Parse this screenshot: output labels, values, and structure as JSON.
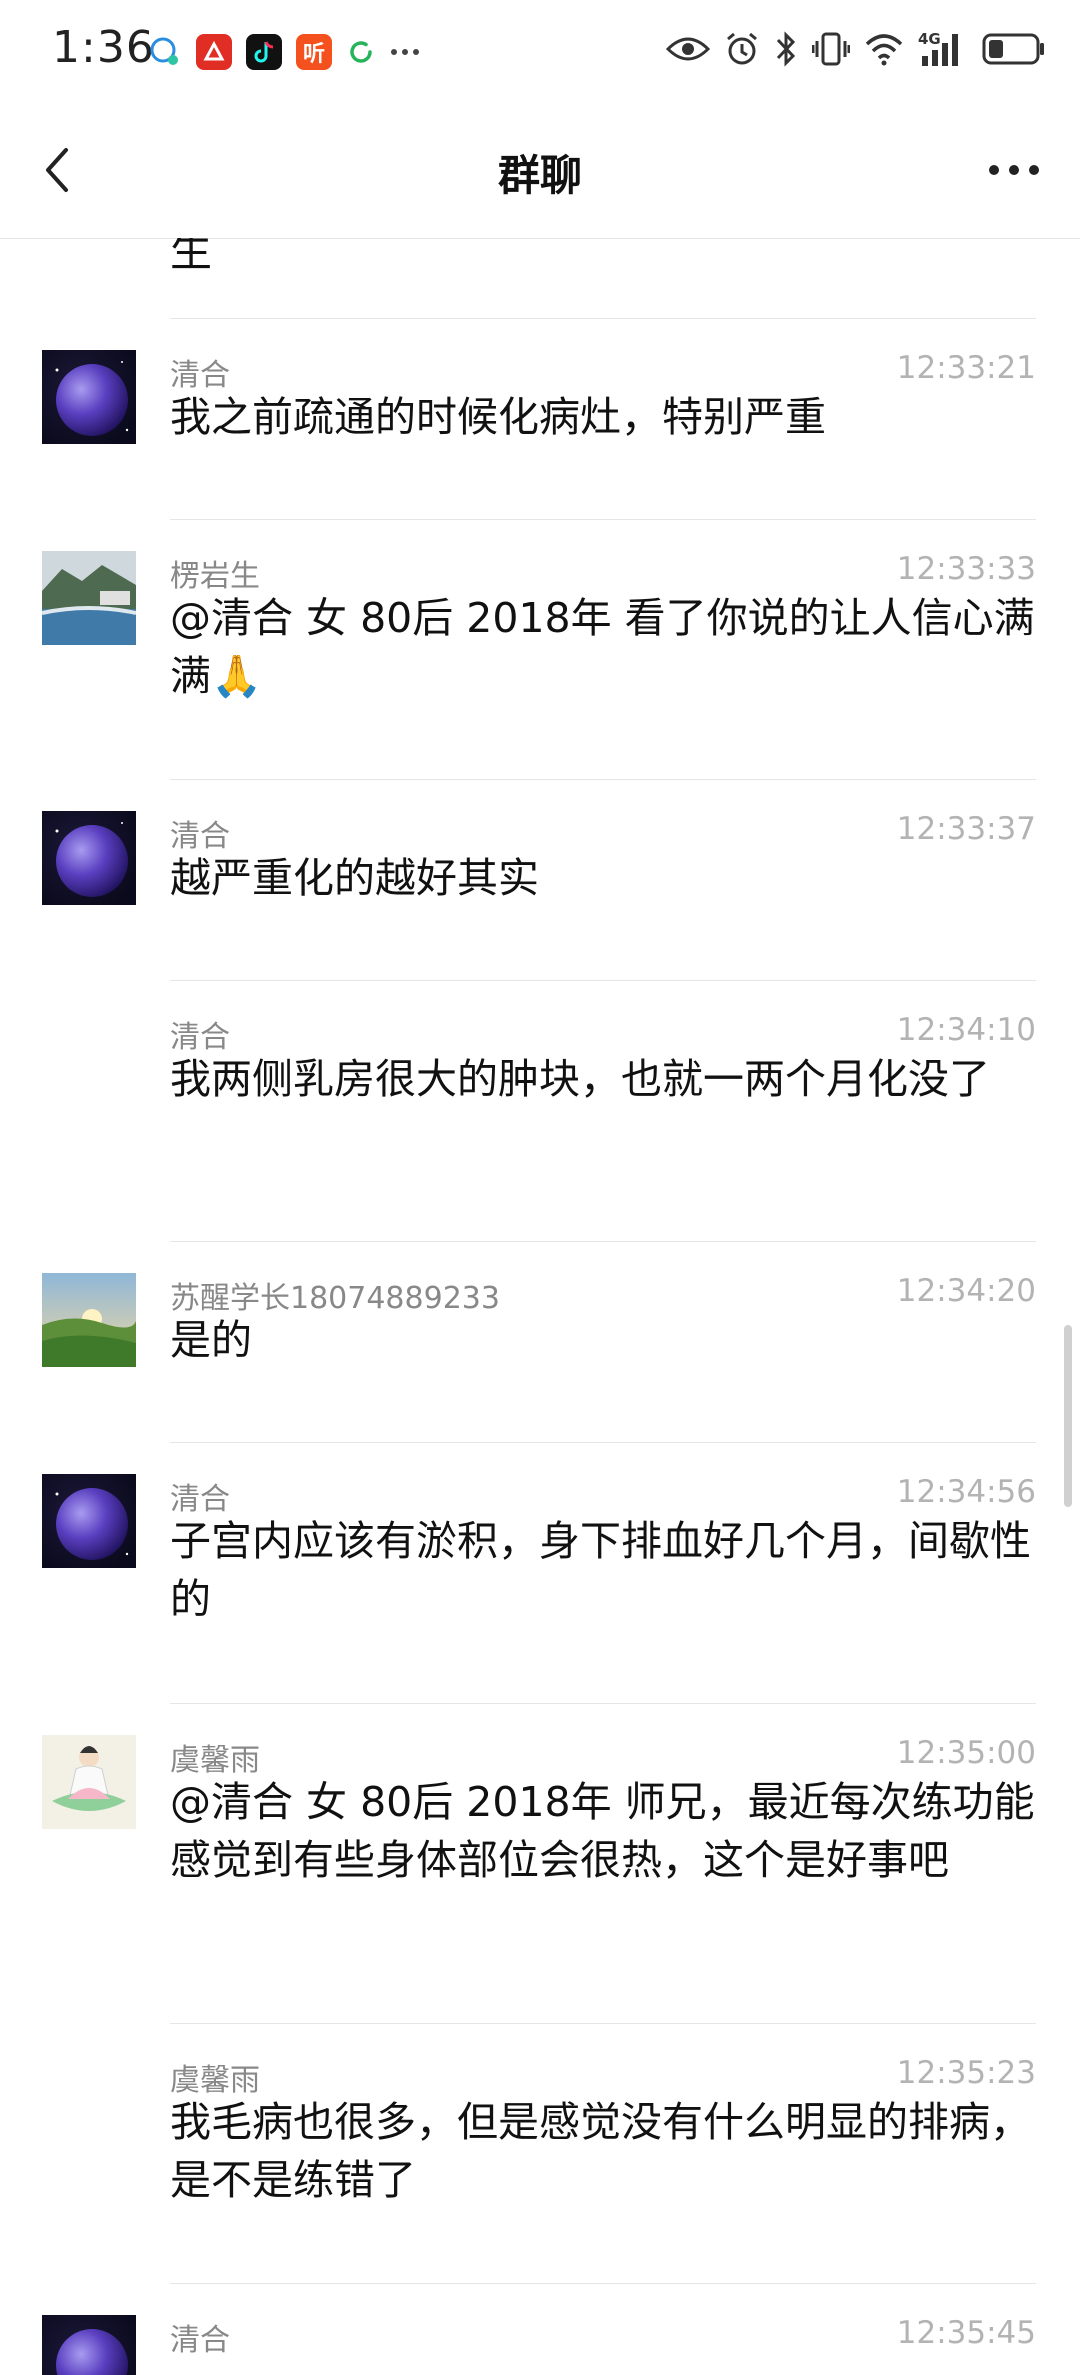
{
  "status_bar": {
    "time": "1:36",
    "left_icons": [
      "messenger-icon",
      "pinduoduo-app-icon",
      "tiktok-app-icon",
      "audio-app-icon",
      "sync-icon",
      "more-dots-icon"
    ],
    "right_icons": [
      "eye-icon",
      "alarm-icon",
      "bluetooth-icon",
      "vibrate-icon",
      "wifi-icon",
      "signal-4g-icon",
      "battery-icon"
    ],
    "network": "4G",
    "audio_app_label": "听"
  },
  "header": {
    "title": "群聊"
  },
  "chat": {
    "partial_top_text": "生",
    "messages": [
      {
        "sender": "清合",
        "time": "12:33:21",
        "text": "我之前疏通的时候化病灶，特别严重",
        "avatar": "planet-avatar",
        "show_avatar": true
      },
      {
        "sender": "楞岩生",
        "time": "12:33:33",
        "text": "@清合 女 80后  2018年 看了你说的让人信心满满🙏",
        "avatar": "landscape-avatar",
        "show_avatar": true
      },
      {
        "sender": "清合",
        "time": "12:33:37",
        "text": "越严重化的越好其实",
        "avatar": "planet-avatar",
        "show_avatar": true
      },
      {
        "sender": "清合",
        "time": "12:34:10",
        "text": "我两侧乳房很大的肿块，也就一两个月化没了",
        "avatar": "planet-avatar",
        "show_avatar": false
      },
      {
        "sender": "苏醒学长18074889233",
        "time": "12:34:20",
        "text": "是的",
        "avatar": "sunrise-hills-avatar",
        "show_avatar": true
      },
      {
        "sender": "清合",
        "time": "12:34:56",
        "text": "子宫内应该有淤积，身下排血好几个月，间歇性的",
        "avatar": "planet-avatar",
        "show_avatar": true
      },
      {
        "sender": "虞馨雨",
        "time": "12:35:00",
        "text": "@清合 女 80后  2018年 师兄，最近每次练功能感觉到有些身体部位会很热，这个是好事吧",
        "avatar": "lotus-guanyin-avatar",
        "show_avatar": true
      },
      {
        "sender": "虞馨雨",
        "time": "12:35:23",
        "text": "我毛病也很多，但是感觉没有什么明显的排病，是不是练错了",
        "avatar": "lotus-guanyin-avatar",
        "show_avatar": false
      },
      {
        "sender": "清合",
        "time": "12:35:45",
        "text": "",
        "avatar": "planet-avatar",
        "show_avatar": true
      }
    ]
  }
}
